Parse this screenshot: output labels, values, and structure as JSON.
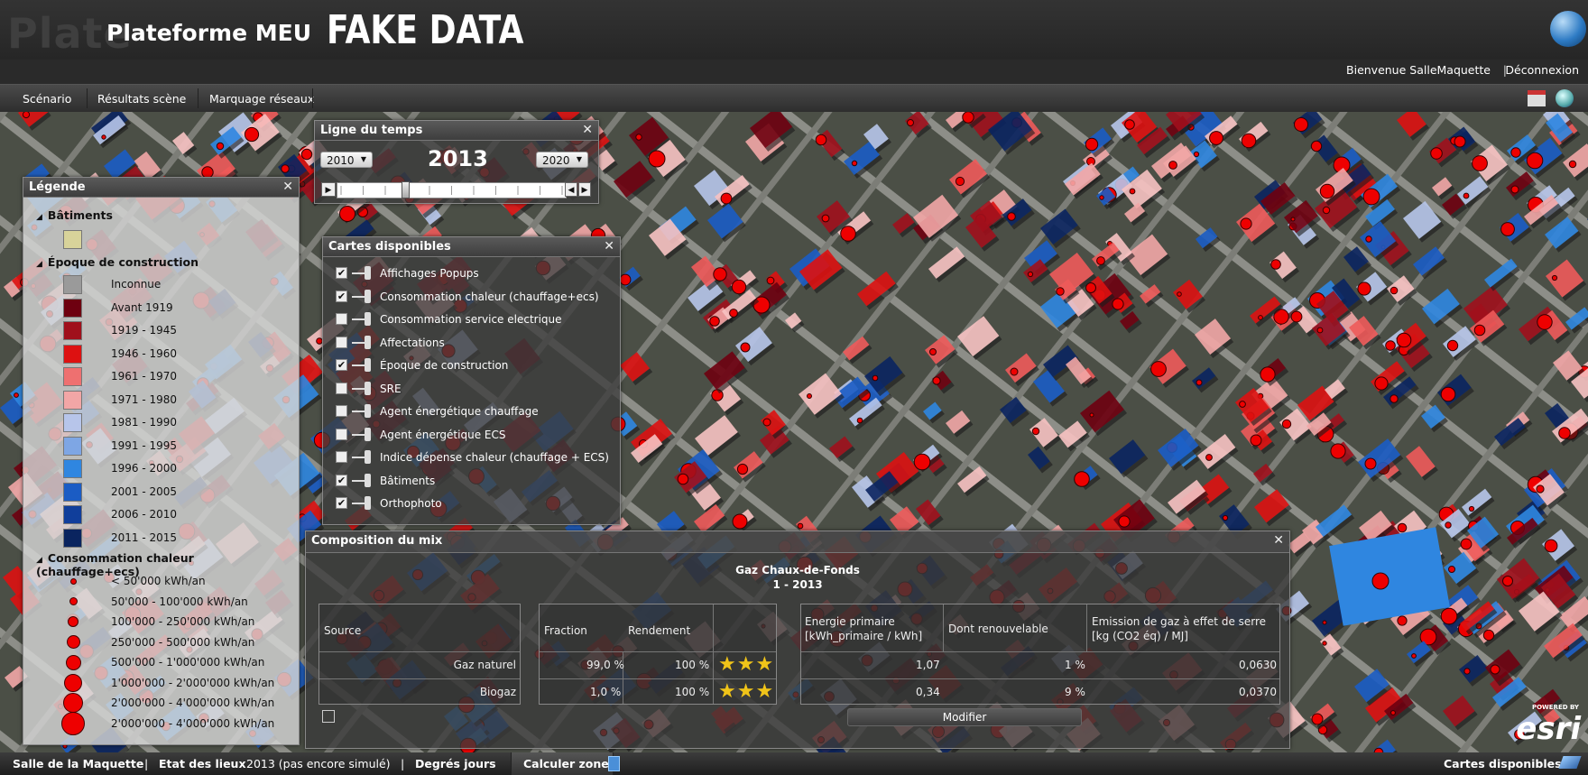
{
  "header": {
    "ghost_text": "Plate",
    "title": "Plateforme MEU",
    "banner": "FAKE DATA",
    "welcome": "Bienvenue SalleMaquette",
    "separator": "|",
    "logout": "Déconnexion"
  },
  "menu": {
    "items": [
      "Scénario",
      "Résultats scène",
      "Marquage réseaux"
    ]
  },
  "timeline": {
    "title": "Ligne du temps",
    "start_year": "2010",
    "current_year": "2013",
    "end_year": "2020",
    "slider_position": 0.22
  },
  "legend": {
    "title": "Légende",
    "sections": {
      "buildings": "Bâtiments",
      "epoch": "Époque de construction",
      "consumption": "Consommation chaleur (chauffage+ecs)"
    },
    "building_color": "#d8d39a",
    "epoch_items": [
      {
        "label": "Inconnue",
        "color": "#9a9a9a"
      },
      {
        "label": "Avant 1919",
        "color": "#6e0010"
      },
      {
        "label": "1919 - 1945",
        "color": "#a0101c"
      },
      {
        "label": "1946 - 1960",
        "color": "#dd1111"
      },
      {
        "label": "1961 - 1970",
        "color": "#ee7070"
      },
      {
        "label": "1971 - 1980",
        "color": "#f2a6a6"
      },
      {
        "label": "1981 - 1990",
        "color": "#b7c5ea"
      },
      {
        "label": "1991 - 1995",
        "color": "#7ea6e4"
      },
      {
        "label": "1996 - 2000",
        "color": "#2f86e0"
      },
      {
        "label": "2001 - 2005",
        "color": "#1b5cc4"
      },
      {
        "label": "2006 - 2010",
        "color": "#103e9b"
      },
      {
        "label": "2011 - 2015",
        "color": "#0a245f"
      }
    ],
    "consumption_items": [
      "< 50'000 kWh/an",
      "50'000 - 100'000 kWh/an",
      "100'000 - 250'000 kWh/an",
      "250'000 - 500'000 kWh/an",
      "500'000 - 1'000'000 kWh/an",
      "1'000'000 - 2'000'000 kWh/an",
      "2'000'000 - 4'000'000 kWh/an",
      "2'000'000 - 4'000'000 kWh/an"
    ]
  },
  "cartes": {
    "title": "Cartes disponibles",
    "layers": [
      {
        "label": "Affichages Popups",
        "checked": true
      },
      {
        "label": "Consommation chaleur (chauffage+ecs)",
        "checked": true
      },
      {
        "label": "Consommation service electrique",
        "checked": false
      },
      {
        "label": "Affectations",
        "checked": false
      },
      {
        "label": "Époque de construction",
        "checked": true
      },
      {
        "label": "SRE",
        "checked": false
      },
      {
        "label": "Agent énergétique chauffage",
        "checked": false
      },
      {
        "label": "Agent énergétique ECS",
        "checked": false
      },
      {
        "label": "Indice dépense chaleur (chauffage + ECS)",
        "checked": false
      },
      {
        "label": "Bâtiments",
        "checked": true
      },
      {
        "label": "Orthophoto",
        "checked": true
      }
    ]
  },
  "mix": {
    "title": "Composition du mix",
    "heading1": "Gaz Chaux-de-Fonds",
    "heading2": "1 - 2013",
    "headers": {
      "source": "Source",
      "fraction": "Fraction",
      "rendement": "Rendement",
      "energie_1": "Energie primaire",
      "energie_2": "[kWh_primaire / kWh]",
      "renouvelable": "Dont renouvelable",
      "emission_1": "Emission de gaz à effet de serre",
      "emission_2": "[kg (CO2 éq) / MJ]"
    },
    "rows": [
      {
        "source": "Gaz naturel",
        "fraction": "99,0 %",
        "rendement": "100 %",
        "stars": 3,
        "energie": "1,07",
        "renouvelable": "1 %",
        "emission": "0,0630"
      },
      {
        "source": "Biogaz",
        "fraction": "1,0 %",
        "rendement": "100 %",
        "stars": 3,
        "energie": "0,34",
        "renouvelable": "9 %",
        "emission": "0,0370"
      }
    ],
    "modify_label": "Modifier"
  },
  "status": {
    "place": "Salle de la Maquette",
    "sep": "|",
    "etat_label": "Etat des lieux",
    "etat_value": "2013 (pas encore simulé)",
    "degres": "Degrés jours",
    "calculer": "Calculer zone",
    "cartes_btn": "Cartes disponibles"
  },
  "map": {
    "attribution_small": "POWERED BY",
    "attribution": "esri"
  }
}
